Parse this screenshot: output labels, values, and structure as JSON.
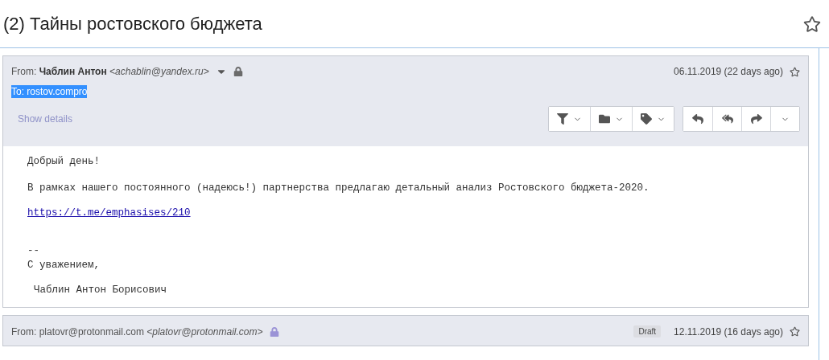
{
  "conversation": {
    "title": "(2) Тайны ростовского бюджета",
    "starred": false
  },
  "messages": [
    {
      "from_label": "From:",
      "sender_name": "Чаблин Антон",
      "sender_address": "<achablin@yandex.ru>",
      "sender_bold": true,
      "lock": {
        "color": "#6b6b6b"
      },
      "date": "06.11.2019 (22 days ago)",
      "starred": false,
      "expanded": true,
      "to": {
        "text": "To: rostov.compro",
        "selected": true
      },
      "details_link": "Show details",
      "toolbar": [
        [
          {
            "kind": "filter",
            "dropdown": true
          },
          {
            "kind": "folder",
            "dropdown": true
          },
          {
            "kind": "tag",
            "dropdown": true
          }
        ],
        [
          {
            "kind": "reply",
            "dropdown": false
          },
          {
            "kind": "reply-all",
            "dropdown": false
          },
          {
            "kind": "forward",
            "dropdown": false
          },
          {
            "kind": "more",
            "dropdown": true
          }
        ]
      ],
      "body": [
        {
          "kind": "greeting",
          "text": "Добрый день!"
        },
        {
          "kind": "paragraph",
          "text": "В рамках нашего постоянного (надеюсь!) партнерства предлагаю детальный анализ Ростовского бюджета-2020."
        },
        {
          "kind": "link",
          "text": "https://t.me/emphasises/210"
        },
        {
          "kind": "separator",
          "text": "--"
        },
        {
          "kind": "closing",
          "text": "С уважением,"
        },
        {
          "kind": "signature",
          "text": "Чаблин Антон Борисович"
        }
      ]
    },
    {
      "from_label": "From:",
      "sender_name": "platovr@protonmail.com",
      "sender_address": "<platovr@protonmail.com>",
      "sender_bold": false,
      "lock": {
        "color": "#9b93d6"
      },
      "badge": "Draft",
      "date": "12.11.2019 (16 days ago)",
      "starred": false,
      "expanded": false
    }
  ]
}
